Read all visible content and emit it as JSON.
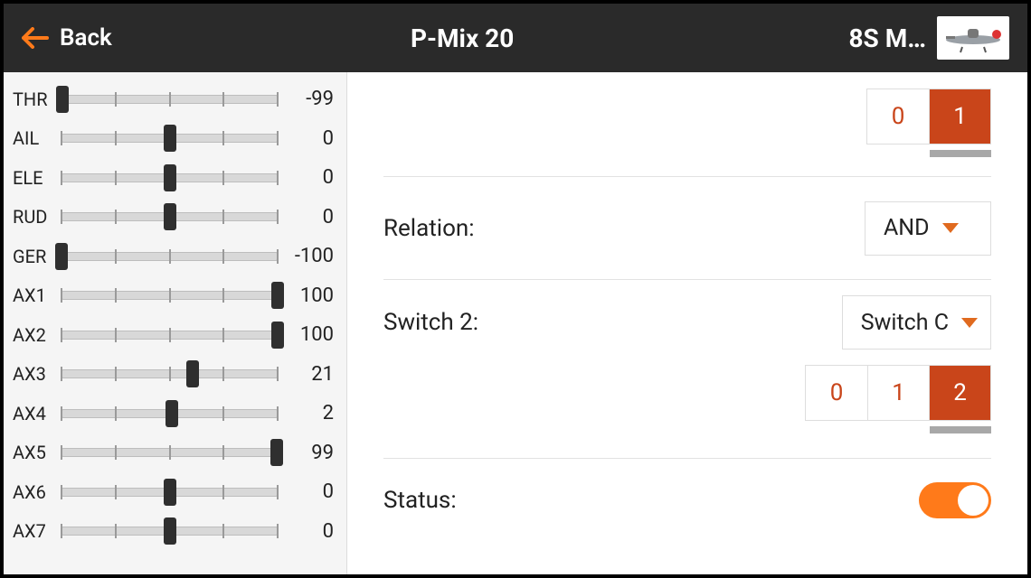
{
  "header": {
    "back_label": "Back",
    "title": "P-Mix 20",
    "model_name": "8S M…"
  },
  "channels": [
    {
      "label": "THR",
      "value": -99
    },
    {
      "label": "AIL",
      "value": 0
    },
    {
      "label": "ELE",
      "value": 0
    },
    {
      "label": "RUD",
      "value": 0
    },
    {
      "label": "GER",
      "value": -100
    },
    {
      "label": "AX1",
      "value": 100
    },
    {
      "label": "AX2",
      "value": 100
    },
    {
      "label": "AX3",
      "value": 21
    },
    {
      "label": "AX4",
      "value": 2
    },
    {
      "label": "AX5",
      "value": 99
    },
    {
      "label": "AX6",
      "value": 0
    },
    {
      "label": "AX7",
      "value": 0
    }
  ],
  "switch1_positions": {
    "options": [
      "0",
      "1"
    ],
    "active_index": 1
  },
  "relation": {
    "label": "Relation:",
    "value": "AND"
  },
  "switch2": {
    "label": "Switch 2:",
    "value": "Switch C"
  },
  "switch2_positions": {
    "options": [
      "0",
      "1",
      "2"
    ],
    "active_index": 2
  },
  "status": {
    "label": "Status:",
    "on": true
  }
}
